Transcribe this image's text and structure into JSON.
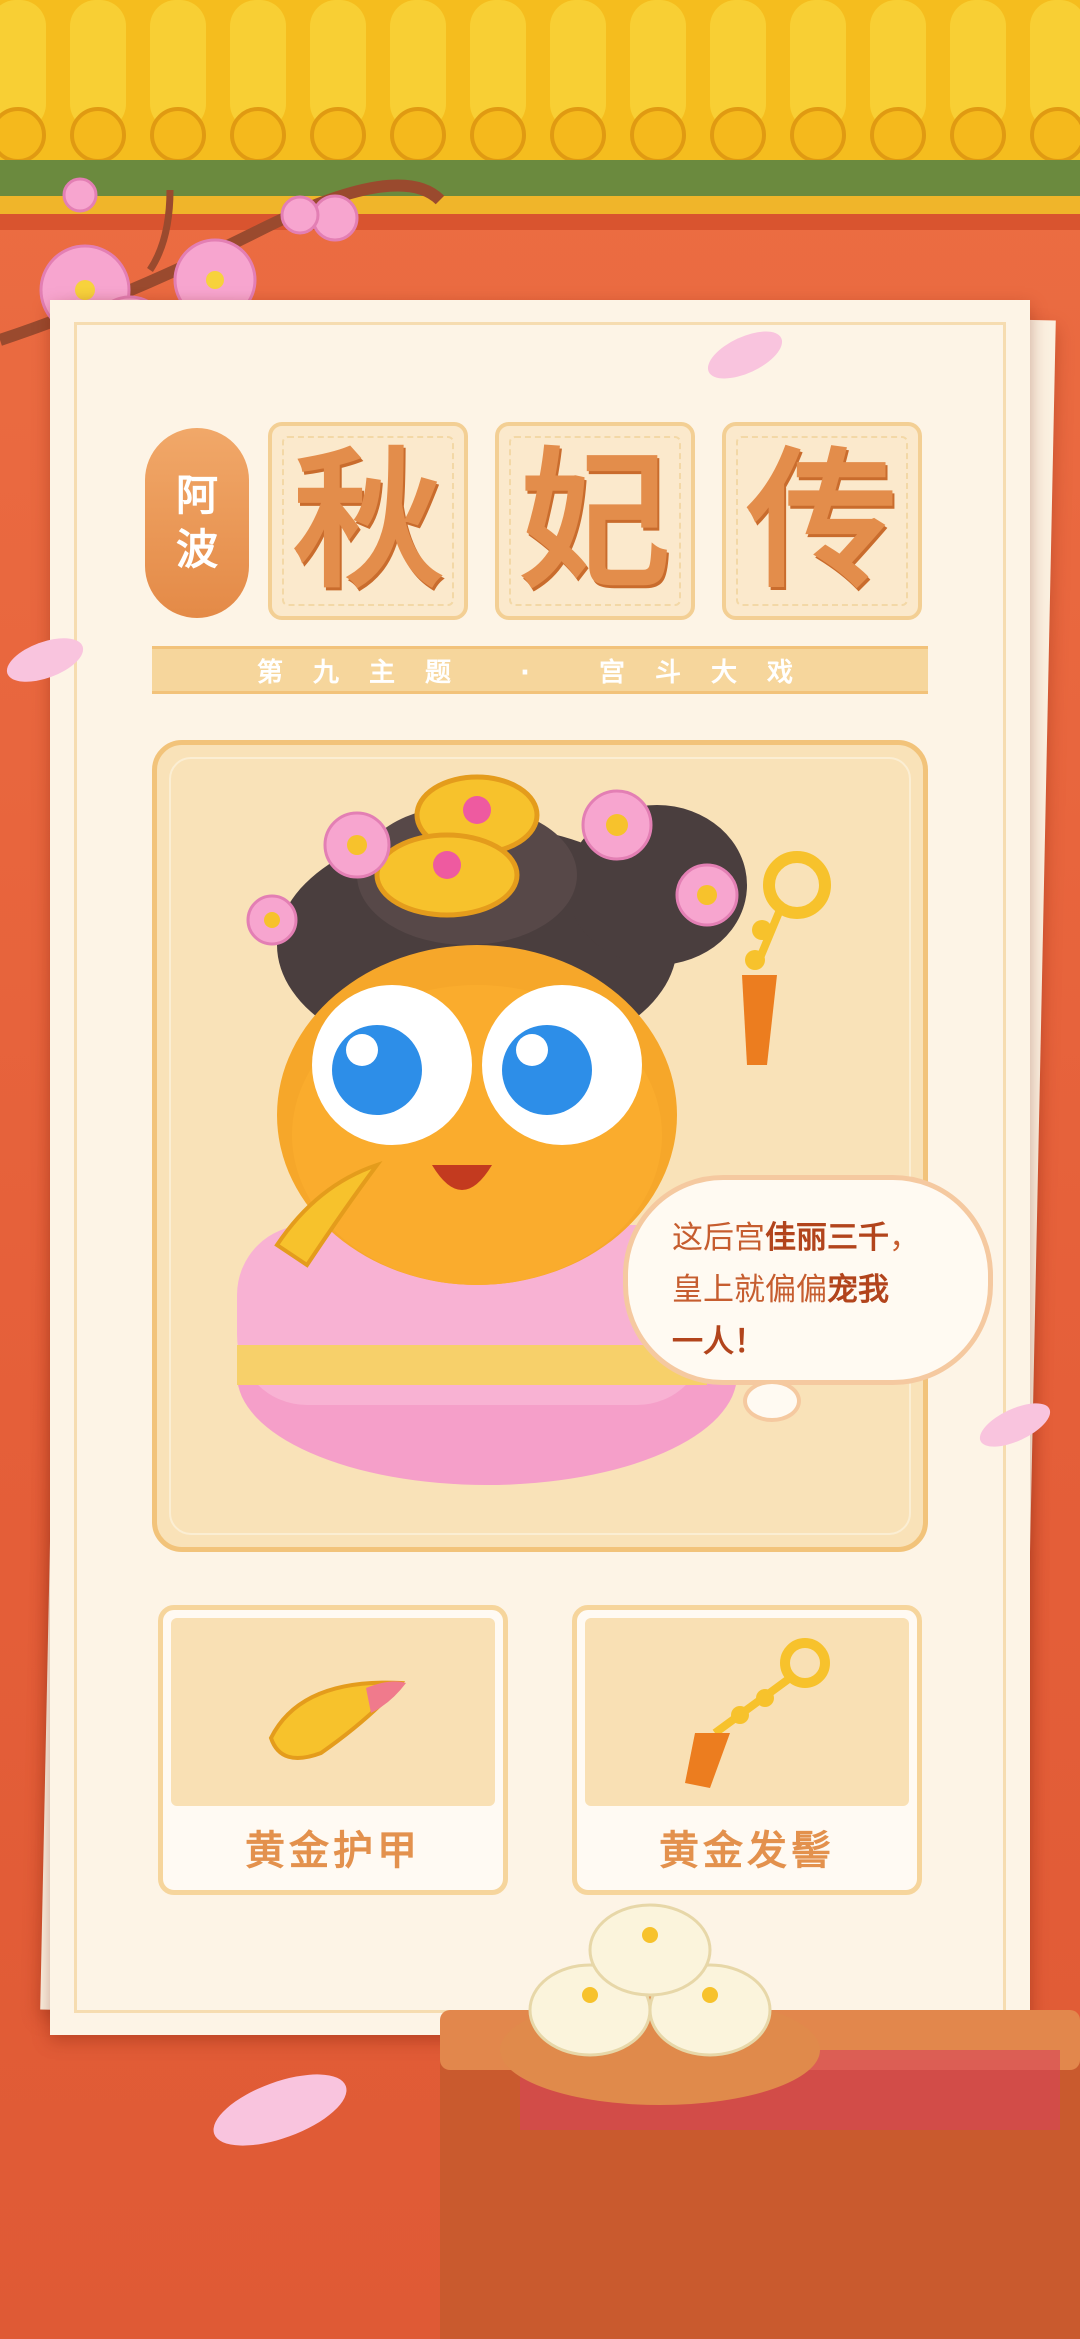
{
  "title": {
    "badge_top": "阿",
    "badge_bottom": "波",
    "char1": "秋",
    "char2": "妃",
    "char3": "传",
    "subtitle": "第九主题 · 宫斗大戏"
  },
  "character": {
    "icon": "concubine-character-illustration"
  },
  "speech_bubble": {
    "line1_plain": "这后宫",
    "line1_bold": "佳丽三千",
    "line1_end": "，",
    "line2_plain": "皇上就偏偏",
    "line2_bold": "宠我",
    "line3": "一人！"
  },
  "items": [
    {
      "label": "黄金护甲",
      "icon": "golden-nail-guard-icon"
    },
    {
      "label": "黄金发髻",
      "icon": "golden-hairpin-icon"
    }
  ],
  "colors": {
    "background": "#e55f39",
    "paper": "#fdf4e6",
    "gold": "#f6d69c",
    "title_orange": "#e38d4b"
  }
}
